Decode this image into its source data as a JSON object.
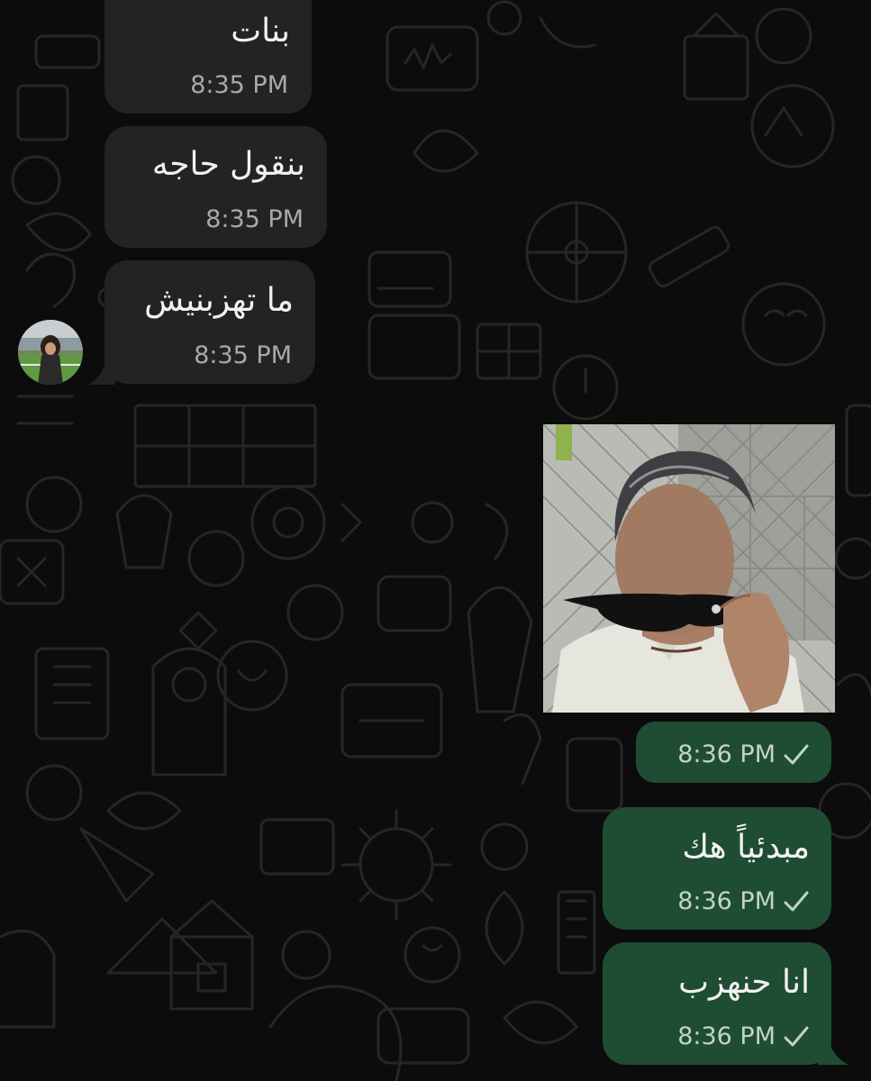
{
  "messages": [
    {
      "direction": "incoming",
      "text": "بنات",
      "time": "8:35 PM"
    },
    {
      "direction": "incoming",
      "text": "بنقول حاجه",
      "time": "8:35 PM"
    },
    {
      "direction": "incoming",
      "text": "ما تهزبنيش",
      "time": "8:35 PM"
    },
    {
      "direction": "outgoing",
      "type": "image",
      "time": "8:36 PM",
      "status": "sent"
    },
    {
      "direction": "outgoing",
      "text": "مبدئياً هك",
      "time": "8:36 PM",
      "status": "sent"
    },
    {
      "direction": "outgoing",
      "text": "انا حنهزب",
      "time": "8:36 PM",
      "status": "sent"
    }
  ],
  "icons": {
    "read_status": "single-check-icon",
    "avatar": "contact-avatar"
  },
  "colors": {
    "background": "#0c0c0c",
    "incoming_bubble": "#232323",
    "outgoing_bubble": "#1f4d33",
    "text": "#f2f2f2",
    "time_incoming": "#a9a9a9",
    "time_outgoing": "#c3d3c8"
  }
}
